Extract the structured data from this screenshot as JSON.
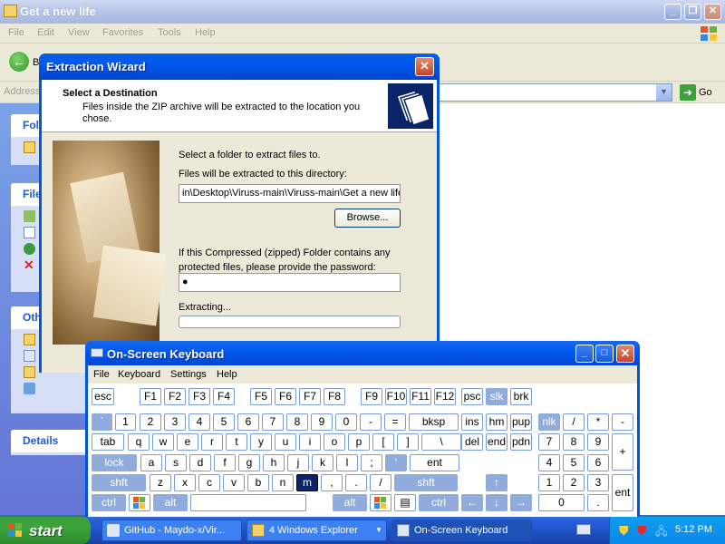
{
  "explorer": {
    "title": "Get a new life",
    "menu": [
      "File",
      "Edit",
      "View",
      "Favorites",
      "Tools",
      "Help"
    ],
    "back_label": "B",
    "address_label": "Address",
    "go_label": "Go",
    "left_panel": {
      "folder_tasks_header": "Fold",
      "file_tasks_header": "File",
      "other_places_header": "Oth",
      "details_header": "Details"
    }
  },
  "wizard": {
    "title": "Extraction Wizard",
    "heading": "Select a Destination",
    "subheading": "Files inside the ZIP archive will be extracted to the location you chose.",
    "select_folder_text": "Select a folder to extract files to.",
    "dir_label": "Files will be extracted to this directory:",
    "dir_value": "in\\Desktop\\Viruss-main\\Viruss-main\\Get a new life",
    "browse_label": "Browse...",
    "password_text": "If this Compressed (zipped) Folder contains any protected files, please provide the password:",
    "password_value": "●",
    "extracting_label": "Extracting...",
    "progress_fraction": 0
  },
  "osk": {
    "title": "On-Screen Keyboard",
    "menu": [
      "File",
      "Keyboard",
      "Settings",
      "Help"
    ],
    "rows": {
      "r1": [
        "esc",
        "F1",
        "F2",
        "F3",
        "F4",
        "F5",
        "F6",
        "F7",
        "F8",
        "F9",
        "F10",
        "F11",
        "F12",
        "psc",
        "slk",
        "brk"
      ],
      "r2": [
        "`",
        "1",
        "2",
        "3",
        "4",
        "5",
        "6",
        "7",
        "8",
        "9",
        "0",
        "-",
        "=",
        "bksp",
        "ins",
        "hm",
        "pup",
        "nlk",
        "/",
        "*",
        "-"
      ],
      "r3": [
        "tab",
        "q",
        "w",
        "e",
        "r",
        "t",
        "y",
        "u",
        "i",
        "o",
        "p",
        "[",
        "]",
        "\\",
        "del",
        "end",
        "pdn",
        "7",
        "8",
        "9",
        "+"
      ],
      "r4": [
        "lock",
        "a",
        "s",
        "d",
        "f",
        "g",
        "h",
        "j",
        "k",
        "l",
        ";",
        "'",
        "ent",
        "4",
        "5",
        "6"
      ],
      "r5": [
        "shft",
        "z",
        "x",
        "c",
        "v",
        "b",
        "n",
        "m",
        ",",
        ".",
        "/",
        "shft",
        "↑",
        "1",
        "2",
        "3",
        "ent"
      ],
      "r6": [
        "ctrl",
        "win",
        "alt",
        "",
        "alt",
        "win",
        "menu",
        "ctrl",
        "←",
        "↓",
        "→",
        "0",
        "."
      ]
    }
  },
  "taskbar": {
    "start_label": "start",
    "buttons": [
      "GitHub - Maydo-x/Vir...",
      "4 Windows Explorer",
      "On-Screen Keyboard"
    ],
    "clock": "5:12 PM"
  }
}
